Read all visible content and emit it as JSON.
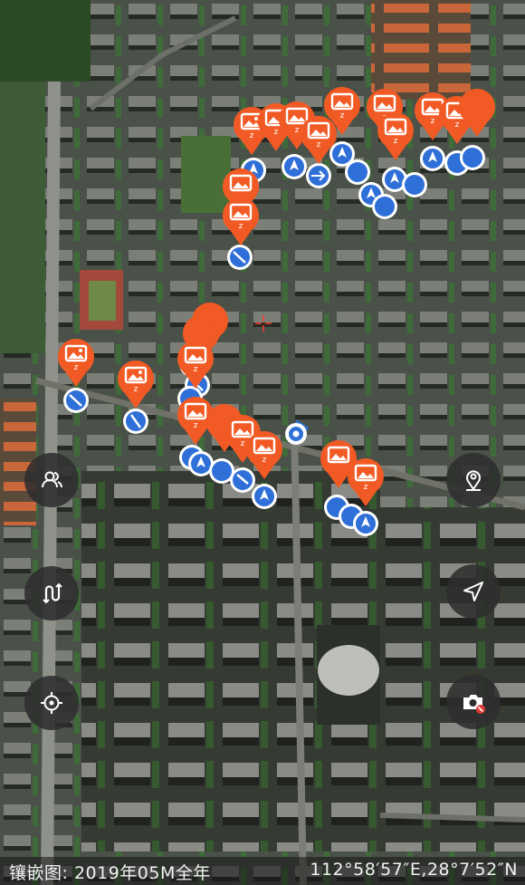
{
  "map": {
    "layer": "satellite",
    "accent_color": "#f15a24",
    "direction_color": "#2f6fd8",
    "footer": {
      "mosaic_label": "镶嵌图:",
      "mosaic_date": "2019年05M全年",
      "coordinates": "112°58′57″E,28°7′52″N"
    }
  },
  "controls": {
    "left": [
      {
        "icon": "users-icon",
        "name": "people-button"
      },
      {
        "icon": "track-icon",
        "name": "track-button"
      },
      {
        "icon": "locate-icon",
        "name": "locate-button"
      }
    ],
    "right": [
      {
        "icon": "map-pin-icon",
        "name": "place-marker-button"
      },
      {
        "icon": "navigate-icon",
        "name": "navigation-button"
      },
      {
        "icon": "camera-icon",
        "name": "camera-button"
      }
    ]
  },
  "markers": {
    "photo_pin_label": "z"
  }
}
